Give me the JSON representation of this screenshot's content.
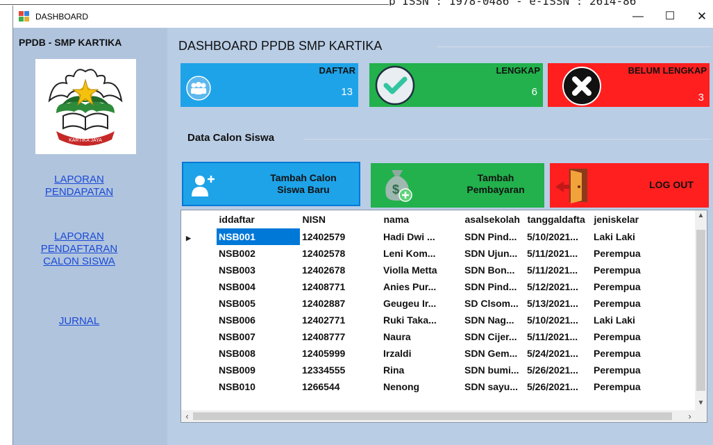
{
  "top_strip_text": "p ISSN : 1978-0486 - e-ISSN : 2614-86",
  "window": {
    "title": "DASHBOARD",
    "minimize": "—",
    "maximize": "☐",
    "close": "✕"
  },
  "sidebar": {
    "title": "PPDB - SMP KARTIKA",
    "logo_text": "KARTIKA JAYA",
    "links": [
      {
        "label_lines": [
          "LAPORAN",
          "PENDAPATAN"
        ]
      },
      {
        "label_lines": [
          "LAPORAN",
          "PENDAFTARAN",
          "CALON SISWA"
        ]
      },
      {
        "label_lines": [
          "JURNAL"
        ]
      }
    ]
  },
  "dashboard": {
    "title": "DASHBOARD PPDB SMP KARTIKA",
    "cards": [
      {
        "label": "DAFTAR",
        "value": "13",
        "color": "#1ea3e8",
        "icon": "users-icon"
      },
      {
        "label": "LENGKAP",
        "value": "6",
        "color": "#22b14c",
        "icon": "check-icon"
      },
      {
        "label": "BELUM LENGKAP",
        "value": "3",
        "color": "#ff1f1f",
        "icon": "x-icon"
      }
    ]
  },
  "data_section": {
    "title": "Data Calon Siswa",
    "buttons": [
      {
        "label": "Tambah Calon Siswa Baru",
        "lines": [
          "Tambah Calon",
          "Siswa Baru"
        ],
        "color": "#1ea3e8",
        "icon": "add-user-icon"
      },
      {
        "label": "Tambah Pembayaran",
        "lines": [
          "Tambah",
          "Pembayaran"
        ],
        "color": "#22b14c",
        "icon": "money-bag-icon"
      },
      {
        "label": "LOG OUT",
        "lines": [
          "LOG OUT"
        ],
        "color": "#ff1f1f",
        "icon": "door-exit-icon"
      }
    ]
  },
  "table": {
    "columns": [
      "iddaftar",
      "NISN",
      "nama",
      "asalsekolah",
      "tanggaldafta",
      "jeniskelar"
    ],
    "rows": [
      [
        "NSB001",
        "12402579",
        "Hadi Dwi ...",
        "SDN Pind...",
        "5/10/2021...",
        "Laki Laki"
      ],
      [
        "NSB002",
        "12402578",
        "Leni Kom...",
        "SDN Ujun...",
        "5/11/2021...",
        "Perempua"
      ],
      [
        "NSB003",
        "12402678",
        "Violla Metta",
        "SDN Bon...",
        "5/11/2021...",
        "Perempua"
      ],
      [
        "NSB004",
        "12408771",
        "Anies Pur...",
        "SDN Pind...",
        "5/12/2021...",
        "Perempua"
      ],
      [
        "NSB005",
        "12402887",
        "Geugeu Ir...",
        "SD Clsom...",
        "5/13/2021...",
        "Perempua"
      ],
      [
        "NSB006",
        "12402771",
        "Ruki Taka...",
        "SDN Nag...",
        "5/10/2021...",
        "Laki Laki"
      ],
      [
        "NSB007",
        "12408777",
        "Naura",
        "SDN Cijer...",
        "5/11/2021...",
        "Perempua"
      ],
      [
        "NSB008",
        "12405999",
        "Irzaldi",
        "SDN Gem...",
        "5/24/2021...",
        "Perempua"
      ],
      [
        "NSB009",
        "12334555",
        "Rina",
        "SDN bumi...",
        "5/26/2021...",
        "Perempua"
      ],
      [
        "NSB010",
        "1266544",
        "Nenong",
        "SDN sayu...",
        "5/26/2021...",
        "Perempua"
      ]
    ],
    "selected_row": 0
  },
  "colors": {
    "client_bg": "#b9cde5",
    "selection": "#0078d7",
    "link": "#1a4ad6"
  }
}
